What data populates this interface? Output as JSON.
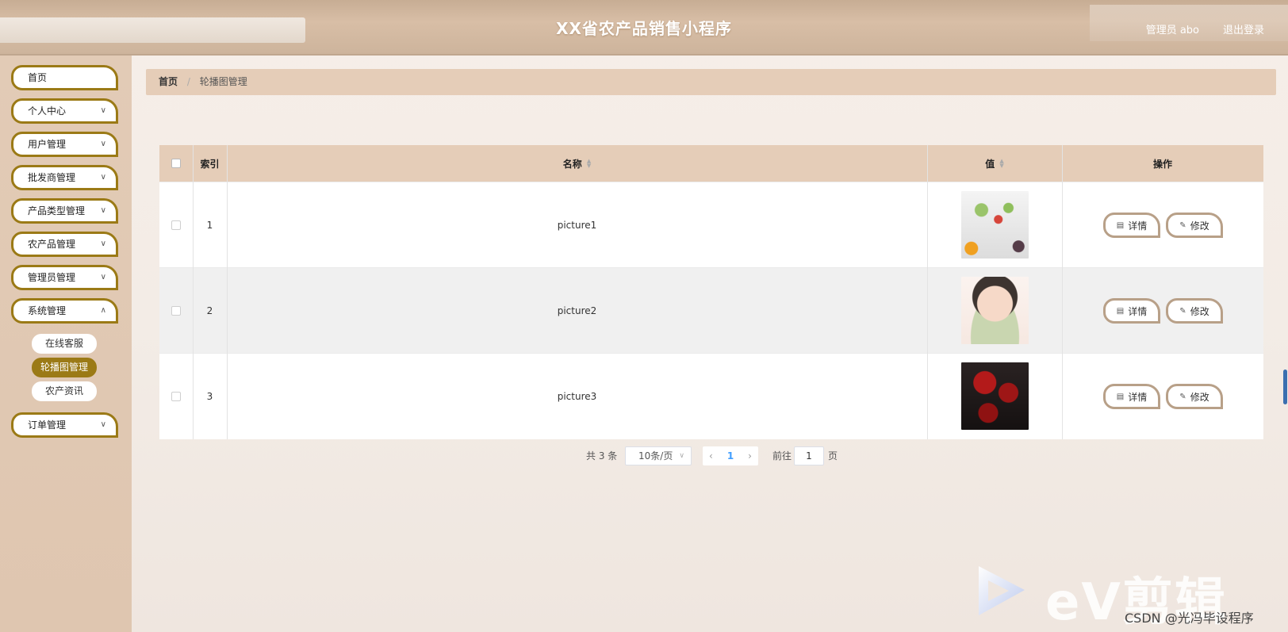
{
  "header": {
    "title": "XX省农产品销售小程序",
    "user": "管理员 abo",
    "logout": "退出登录"
  },
  "sidebar": {
    "items": [
      {
        "label": "首页"
      },
      {
        "label": "个人中心"
      },
      {
        "label": "用户管理"
      },
      {
        "label": "批发商管理"
      },
      {
        "label": "产品类型管理"
      },
      {
        "label": "农产品管理"
      },
      {
        "label": "管理员管理"
      },
      {
        "label": "系统管理"
      },
      {
        "label": "订单管理"
      }
    ],
    "system_sub": [
      {
        "label": "在线客服"
      },
      {
        "label": "轮播图管理",
        "active": true
      },
      {
        "label": "农产资讯"
      }
    ]
  },
  "breadcrumb": {
    "home": "首页",
    "separator": "/",
    "current": "轮播图管理"
  },
  "table": {
    "columns": [
      "索引",
      "名称",
      "值",
      "操作"
    ],
    "rows": [
      {
        "index": "1",
        "name": "picture1"
      },
      {
        "index": "2",
        "name": "picture2"
      },
      {
        "index": "3",
        "name": "picture3"
      }
    ],
    "actions": {
      "detail": "详情",
      "edit": "修改"
    }
  },
  "pagination": {
    "total": "共 3 条",
    "page_size": "10条/页",
    "current_page": "1",
    "goto_label": "前往",
    "goto_value": "1",
    "page_suffix": "页"
  },
  "watermarks": {
    "ev": "eV剪辑",
    "csdn": "CSDN @光冯毕设程序"
  },
  "colors": {
    "accent": "#9b7a16",
    "header_bg": "#d2b8a0",
    "table_head": "#e5cdb8"
  }
}
